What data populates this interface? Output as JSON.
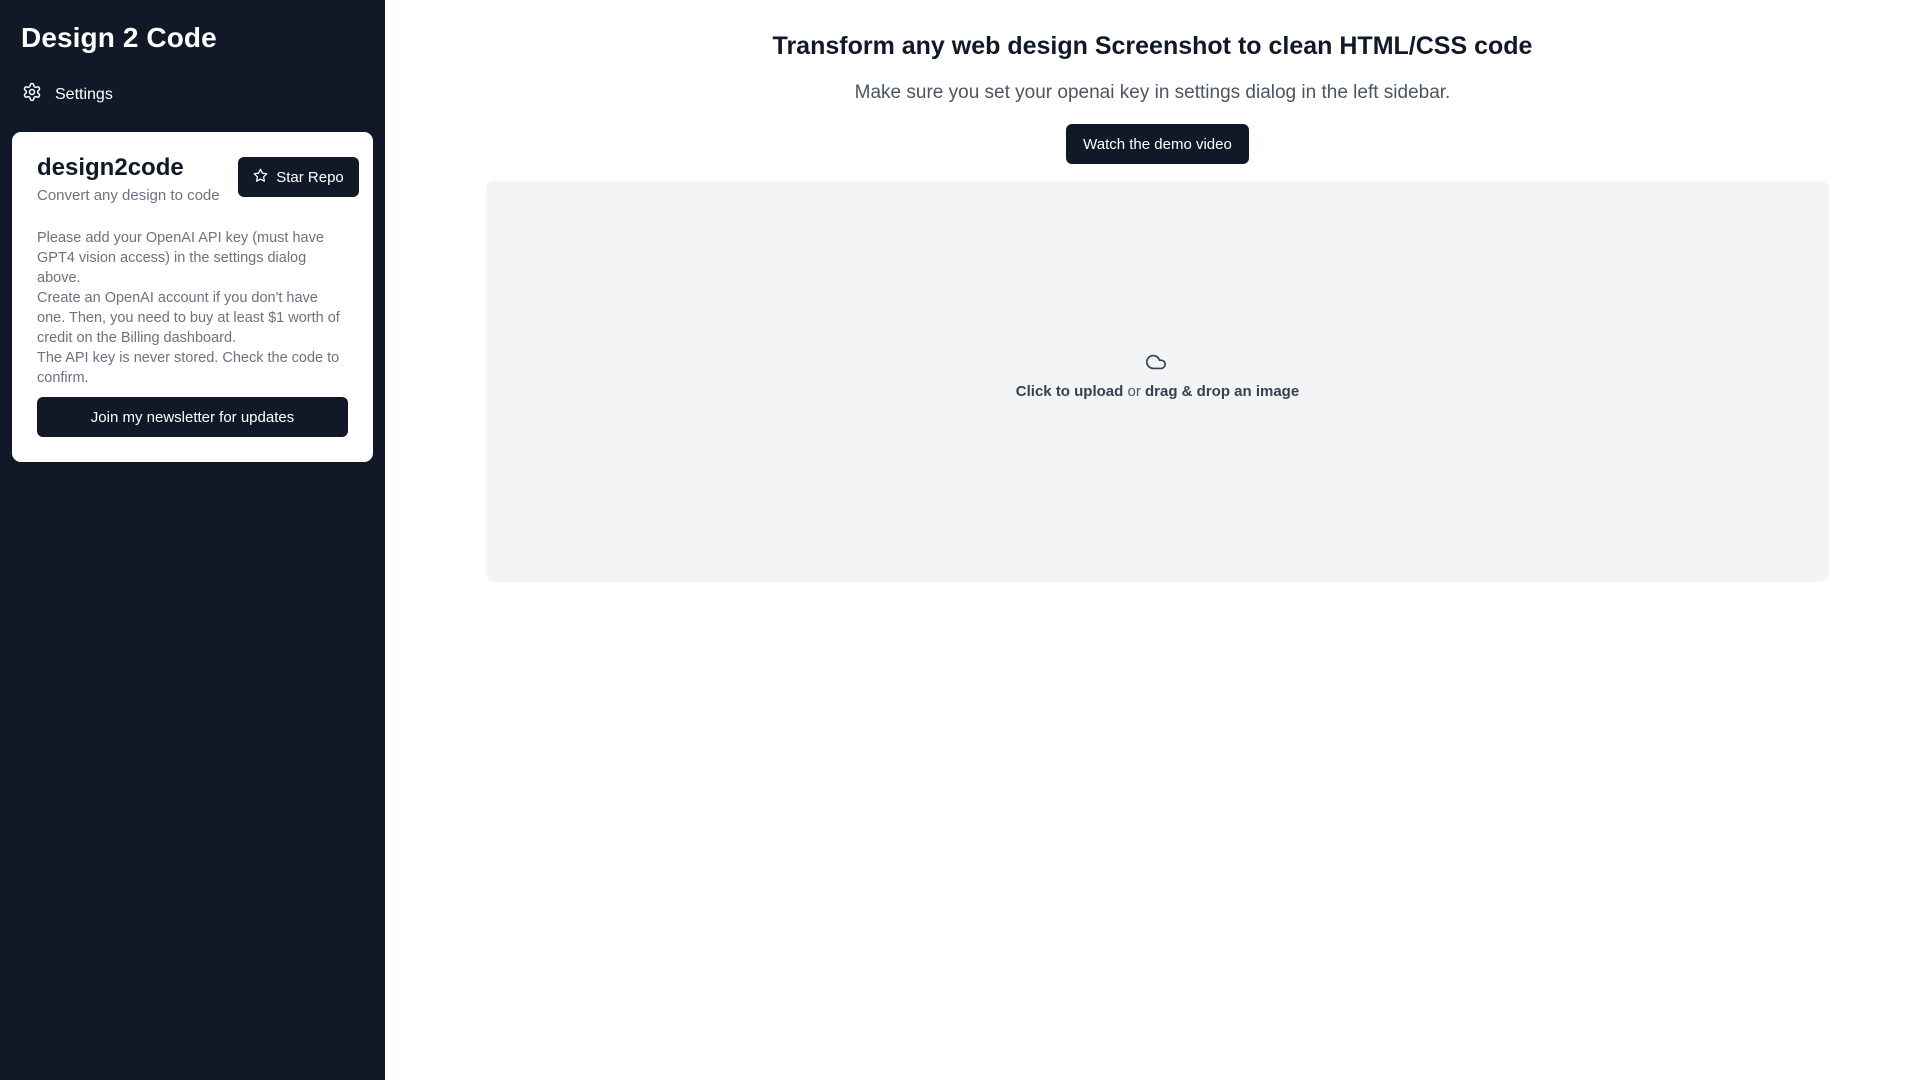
{
  "sidebar": {
    "brand": "Design 2 Code",
    "settings_label": "Settings",
    "card": {
      "title": "design2code",
      "subtitle": "Convert any design to code",
      "star_label": "Star Repo",
      "paragraphs": [
        "Please add your OpenAI API key (must have GPT4 vision access) in the settings dialog above.",
        "Create an OpenAI account if you don't have one. Then, you need to buy at least $1 worth of credit on the Billing dashboard.",
        "The API key is never stored. Check the code to confirm."
      ],
      "newsletter_label": "Join my newsletter for updates"
    }
  },
  "main": {
    "title": "Transform any web design Screenshot to clean HTML/CSS code",
    "subtitle": "Make sure you set your openai key in settings dialog in the left sidebar.",
    "demo_label": "Watch the demo video",
    "dropzone": {
      "click_text": "Click to upload",
      "or_text": " or ",
      "drag_text": "drag & drop an image"
    }
  },
  "colors": {
    "sidebar_bg": "#111827",
    "dropzone_bg": "#f3f4f6",
    "button_bg": "#111827"
  },
  "icons": {
    "settings": "gear-icon",
    "star": "star-icon",
    "upload": "cloud-icon"
  }
}
